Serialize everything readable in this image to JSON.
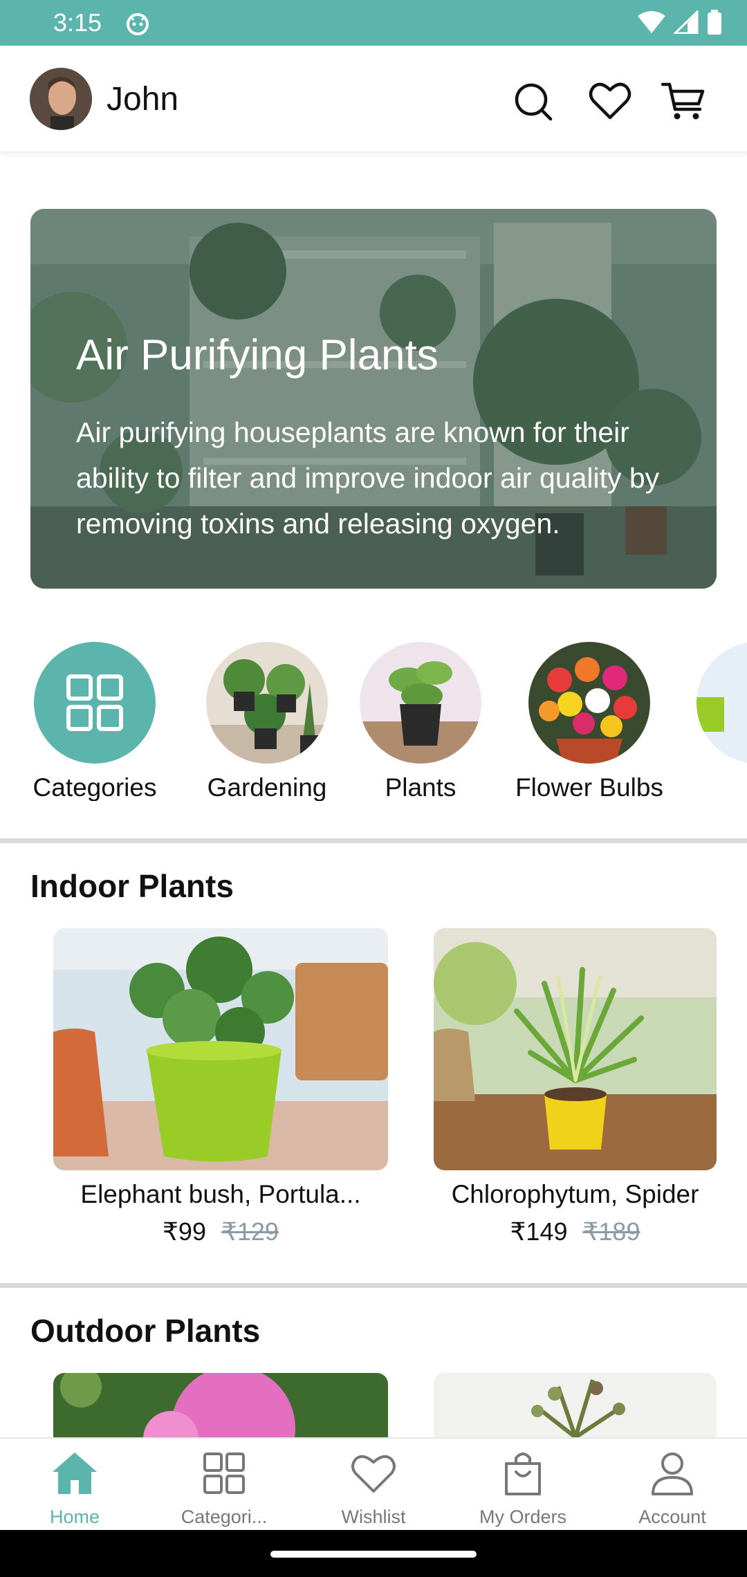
{
  "status_bar": {
    "time": "3:15"
  },
  "header": {
    "user_name": "John",
    "icons": [
      "search-icon",
      "heart-icon",
      "cart-icon"
    ]
  },
  "banner": {
    "title": "Air Purifying Plants",
    "description": "Air purifying houseplants are known for their ability to filter and improve indoor air quality by removing toxins and releasing oxygen."
  },
  "categories": [
    {
      "label": "Categories"
    },
    {
      "label": "Gardening"
    },
    {
      "label": "Plants"
    },
    {
      "label": "Flower Bulbs"
    }
  ],
  "indoor": {
    "title": "Indoor Plants",
    "products": [
      {
        "name": "Elephant bush, Portula...",
        "price": "₹99",
        "old_price": "₹129"
      },
      {
        "name": "Chlorophytum, Spider",
        "price": "₹149",
        "old_price": "₹189"
      }
    ]
  },
  "outdoor": {
    "title": "Outdoor Plants"
  },
  "bottom_nav": [
    {
      "label": "Home"
    },
    {
      "label": "Categori..."
    },
    {
      "label": "Wishlist"
    },
    {
      "label": "My Orders"
    },
    {
      "label": "Account"
    }
  ],
  "colors": {
    "accent": "#5bb5ad",
    "status_bar": "#5bb5ad",
    "nav_inactive": "#777777",
    "old_price": "#8a9aa6"
  }
}
